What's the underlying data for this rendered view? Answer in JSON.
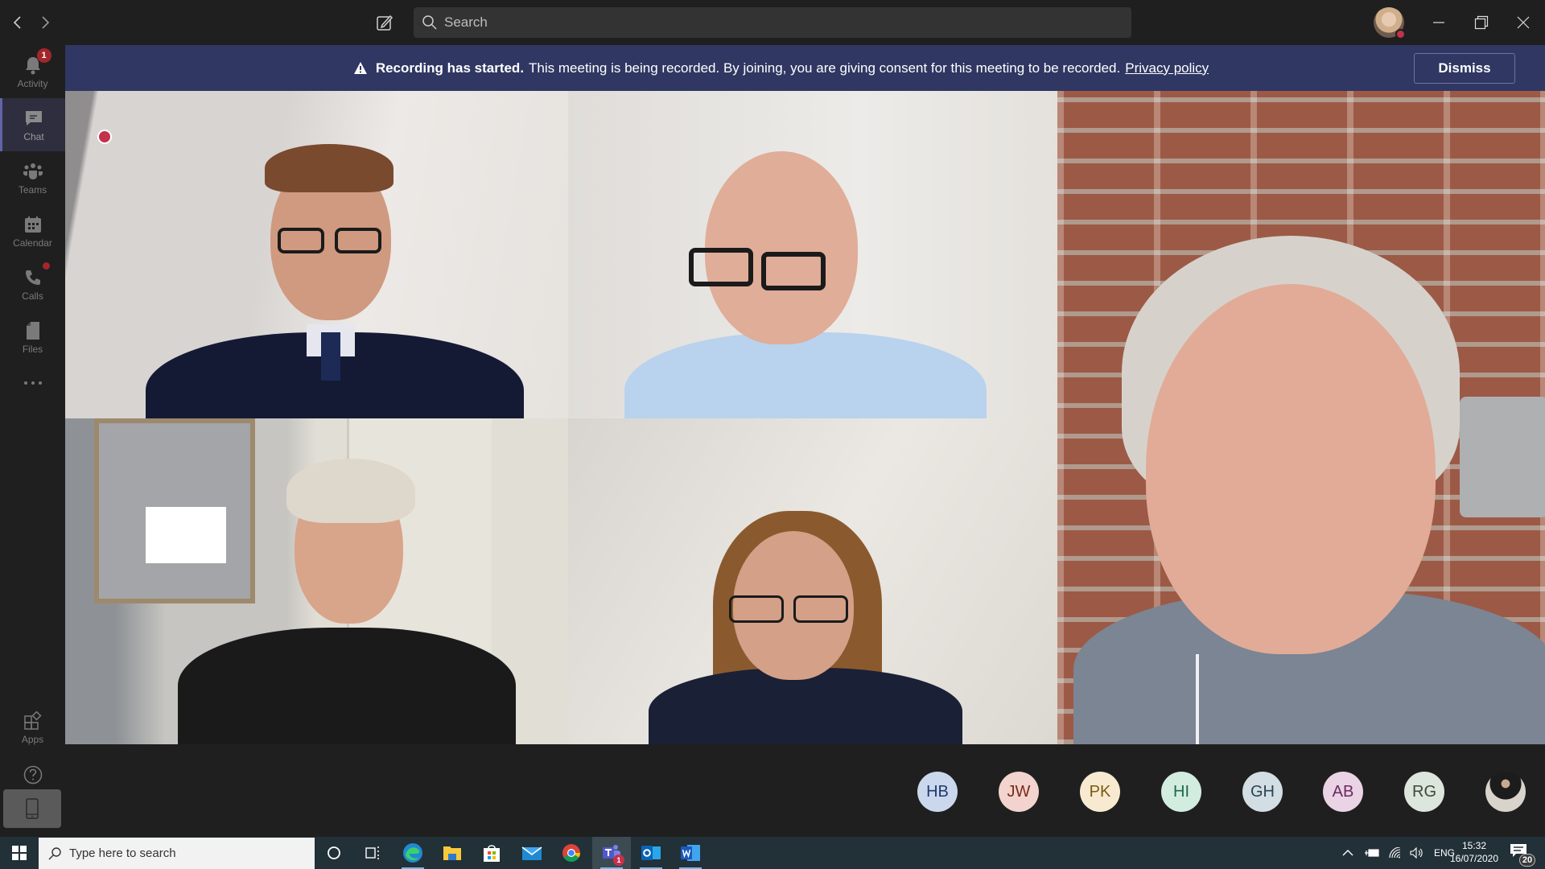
{
  "titlebar": {
    "search_placeholder": "Search",
    "icons": [
      "back-icon",
      "forward-icon",
      "compose-icon",
      "search-icon",
      "minimize-icon",
      "restore-icon",
      "close-icon"
    ]
  },
  "appbar": {
    "items": [
      {
        "label": "Activity",
        "icon": "bell-icon",
        "badge": "1"
      },
      {
        "label": "Chat",
        "icon": "chat-icon",
        "active": true
      },
      {
        "label": "Teams",
        "icon": "teams-icon"
      },
      {
        "label": "Calendar",
        "icon": "calendar-icon"
      },
      {
        "label": "Calls",
        "icon": "phone-icon",
        "dot": true
      },
      {
        "label": "Files",
        "icon": "file-icon"
      },
      {
        "label": "More",
        "icon": "more-icon"
      }
    ],
    "bottom_items": [
      {
        "label": "Apps",
        "icon": "apps-icon"
      },
      {
        "label": "Help",
        "icon": "help-icon"
      }
    ]
  },
  "banner": {
    "title": "Recording has started.",
    "message": "This meeting is being recorded. By joining, you are giving consent for this meeting to be recorded.",
    "link": "Privacy policy",
    "dismiss_label": "Dismiss",
    "bg_color": "#2f3762"
  },
  "recording_indicator_color": "#c4314b",
  "participants": [
    {
      "initials": "HB",
      "bg": "#cbd7ec",
      "fg": "#1f3a6e"
    },
    {
      "initials": "JW",
      "bg": "#f2d3cd",
      "fg": "#7a2a1d"
    },
    {
      "initials": "PK",
      "bg": "#f8ead0",
      "fg": "#7a5a14"
    },
    {
      "initials": "HI",
      "bg": "#d2ecdf",
      "fg": "#1d6a47"
    },
    {
      "initials": "GH",
      "bg": "#d2dde4",
      "fg": "#2a4554"
    },
    {
      "initials": "AB",
      "bg": "#e9d3e5",
      "fg": "#6a2a5e"
    },
    {
      "initials": "RG",
      "bg": "#dde6dc",
      "fg": "#3a4a38"
    },
    {
      "initials": "",
      "photo": true
    }
  ],
  "taskbar": {
    "search_placeholder": "Type here to search",
    "apps": [
      "cortana-icon",
      "task-view-icon",
      "edge-icon",
      "file-explorer-icon",
      "store-icon",
      "mail-icon",
      "chrome-icon",
      "teams-app-icon",
      "outlook-icon",
      "word-icon"
    ],
    "teams_badge": "1",
    "language": "ENG",
    "time": "15:32",
    "date": "16/07/2020",
    "notification_count": "20"
  }
}
